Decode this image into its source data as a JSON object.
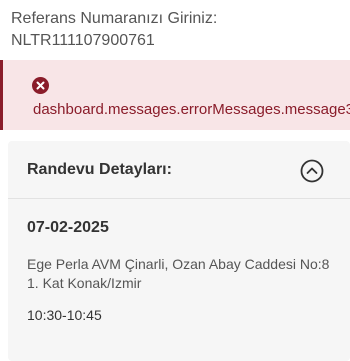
{
  "reference": {
    "prompt": "Referans Numaranızı Giriniz:",
    "value": "NLTR111107900761"
  },
  "error": {
    "icon": "error-x-circle-icon",
    "message": "dashboard.messages.errorMessages.message3",
    "color": "#8a1c2a",
    "background": "#f8e5e7"
  },
  "appointment": {
    "title": "Randevu Detayları:",
    "collapse_icon": "chevron-up-circle-icon",
    "date": "07-02-2025",
    "address": "Ege Perla AVM Çinarli, Ozan Abay Caddesi No:8 1. Kat Konak/Izmir",
    "time": "10:30-10:45"
  }
}
